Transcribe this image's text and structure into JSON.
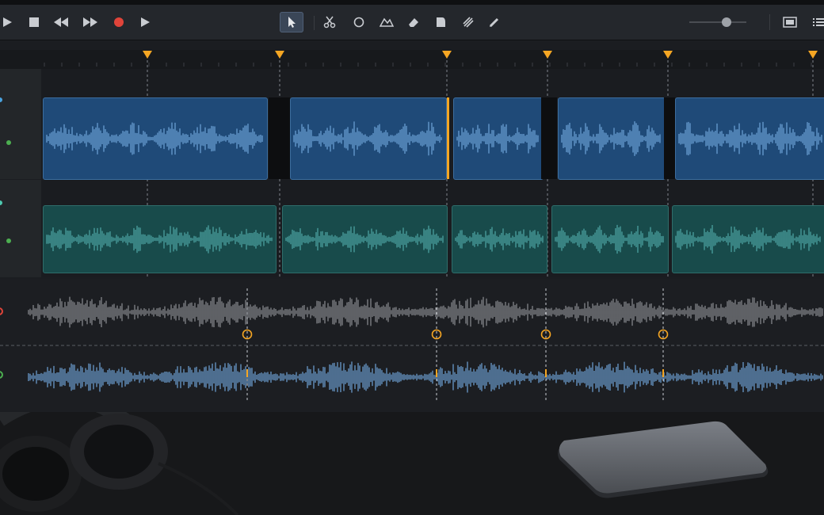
{
  "app": {
    "accent": "#f5a623",
    "clip_blue": "#1f4a78",
    "clip_teal": "#184b4b",
    "wave_blue": "#6fa4d8",
    "wave_teal": "#4fa8a6",
    "wave_gray": "#8c8e92",
    "record_color": "#e0443a"
  },
  "toolbar": {
    "transport": [
      "play-icon",
      "stop-icon",
      "rewind-icon",
      "fast-forward-icon",
      "record-icon",
      "play-icon"
    ],
    "tools": [
      "pointer-icon",
      "scissors-icon",
      "loop-icon",
      "crossfade-icon",
      "eraser-icon",
      "fade-icon",
      "slip-icon",
      "pencil-icon"
    ],
    "selected_tool": "pointer-icon",
    "zoom_level": 0.65,
    "right_icons": [
      "view-toggle-icon",
      "list-icon"
    ]
  },
  "tracks": [
    {
      "name": "",
      "type": "audio",
      "clip_color": "blue",
      "indicator": "#4caf50"
    },
    {
      "name": "",
      "type": "audio",
      "clip_color": "teal",
      "indicator": "#4caf50"
    }
  ],
  "markers": {
    "count": 6
  },
  "analysis": {
    "lanes": [
      "gray-waveform",
      "blue-waveform"
    ],
    "transient_markers": 4
  }
}
